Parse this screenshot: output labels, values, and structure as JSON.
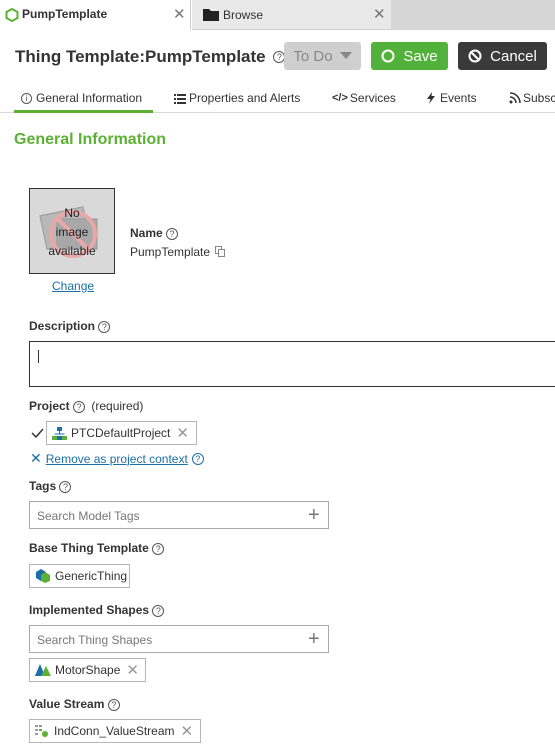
{
  "tabs": [
    {
      "label": "PumpTemplate",
      "close": "✕"
    },
    {
      "label": "Browse",
      "close": "✕"
    }
  ],
  "header": {
    "title": "Thing Template:PumpTemplate",
    "todo_label": "To Do",
    "save_label": "Save",
    "cancel_label": "Cancel"
  },
  "nav": [
    {
      "label": "General Information"
    },
    {
      "label": "Properties and Alerts"
    },
    {
      "label": "Services"
    },
    {
      "label": "Events"
    },
    {
      "label": "Subsc"
    }
  ],
  "section_title": "General Information",
  "image": {
    "placeholder_lines": [
      "No",
      "image",
      "available"
    ],
    "change_label": "Change"
  },
  "name": {
    "label": "Name",
    "value": "PumpTemplate"
  },
  "description": {
    "label": "Description",
    "value": ""
  },
  "project": {
    "label": "Project",
    "required": "(required)",
    "value": "PTCDefaultProject",
    "remove_label": "Remove as project context"
  },
  "tags": {
    "label": "Tags",
    "placeholder": "Search Model Tags"
  },
  "base_template": {
    "label": "Base Thing Template",
    "value": "GenericThing"
  },
  "shapes": {
    "label": "Implemented Shapes",
    "placeholder": "Search Thing Shapes",
    "value": "MotorShape"
  },
  "value_stream": {
    "label": "Value Stream",
    "value": "IndConn_ValueStream"
  },
  "colors": {
    "accent_green": "#5cb135",
    "save_green": "#52b13a",
    "cancel_dark": "#3a3a3a",
    "link_blue": "#1a6fa8"
  }
}
